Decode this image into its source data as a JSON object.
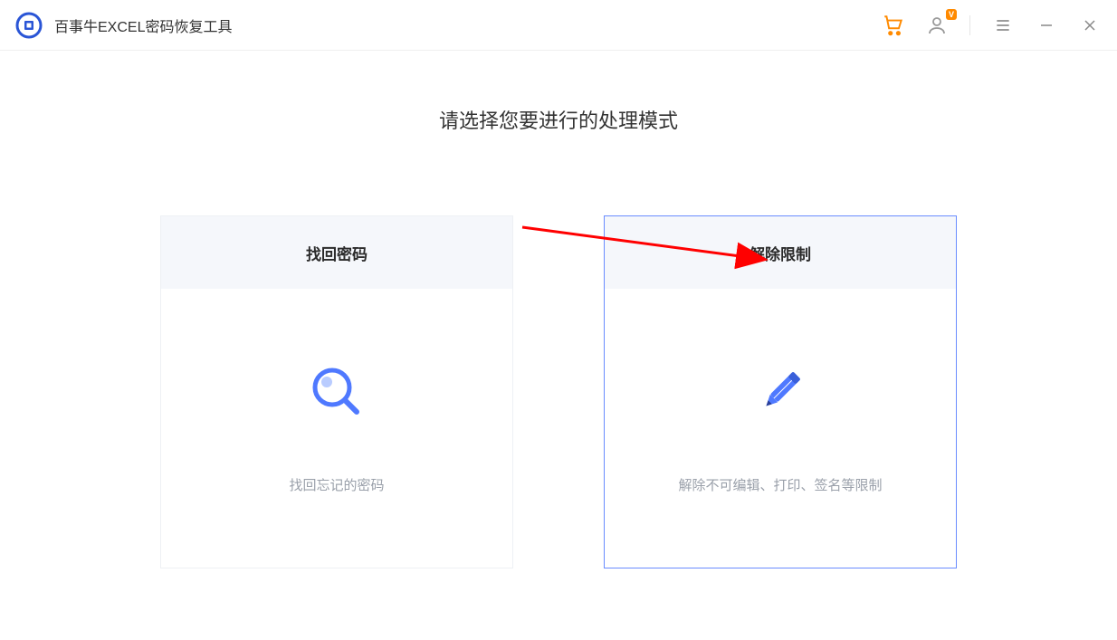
{
  "app": {
    "title": "百事牛EXCEL密码恢复工具",
    "vip_badge": "V"
  },
  "main": {
    "prompt": "请选择您要进行的处理模式"
  },
  "cards": {
    "recover": {
      "title": "找回密码",
      "desc": "找回忘记的密码"
    },
    "unlock": {
      "title": "解除限制",
      "desc": "解除不可编辑、打印、签名等限制"
    }
  }
}
